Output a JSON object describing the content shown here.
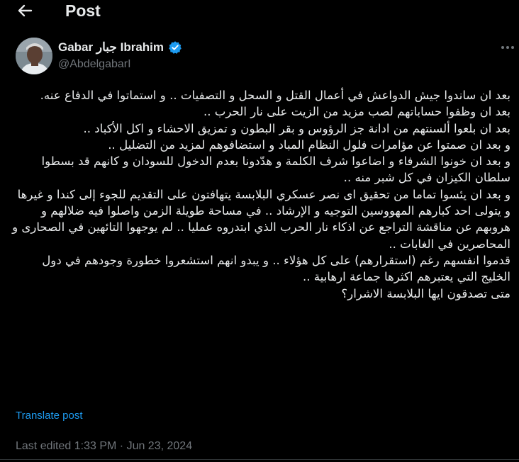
{
  "header": {
    "title": "Post",
    "back_icon": "arrow-left-icon"
  },
  "author": {
    "name": "Gabar جبار Ibrahim",
    "handle": "@AbdelgabarI",
    "verified": true,
    "verified_color": "#1d9bf0"
  },
  "post": {
    "lines": [
      "بعد ان ساندوا جيش الدواعش في أعمال القتل و السحل و التصفيات .. و استماتوا في الدفاع عنه.",
      "بعد ان وظفوا حساباتهم لصب مزيد من الزيت على نار الحرب ..",
      "بعد ان بلعوا ألسنتهم من ادانة جز الرؤوس و بقر البطون و تمزيق الاحشاء و اكل الأكباد ..",
      "و بعد ان صمتوا عن مؤامرات فلول النظام المباد و استضافوهم لمزيد من التضليل ..",
      "و بعد ان خونوا الشرفاء و اضاعوا شرف الكلمة و هدّدونا بعدم الدخول للسودان و كانهم قد بسطوا سلطان الكيزان في كل شبر منه ..",
      "و بعد ان يئسوا تماما من تحقيق اى نصر عسكري البلابسة يتهافتون على التقديم للجوء إلى كندا و غيرها و يتولى احد كبارهم المهووسين التوجيه و الإرشاد .. في مساحة طويلة الزمن واصلوا فيه ضلالهم و هروبهم عن مناقشة التراجع عن اذكاء نار الحرب الذي ابتدروه عمليا .. لم يوجهوا التائهين في الصحارى و المحاصرين في الغابات ..",
      "قدموا انفسهم رغم (استقرارهم) على كل هؤلاء .. و يبدو انهم استشعروا خطورة وجودهم في دول الخليج التي يعتبرهم اكثرها جماعة ارهابية ..",
      "متى تصدقون ايها البلابسة الاشرار؟"
    ]
  },
  "translate_label": "Translate post",
  "edited": {
    "label": "Last edited",
    "time": "1:33 PM",
    "separator": "·",
    "date": "Jun 23, 2024"
  },
  "colors": {
    "background": "#000000",
    "text": "#e7e9ea",
    "muted": "#71767b",
    "accent": "#1d9bf0"
  }
}
